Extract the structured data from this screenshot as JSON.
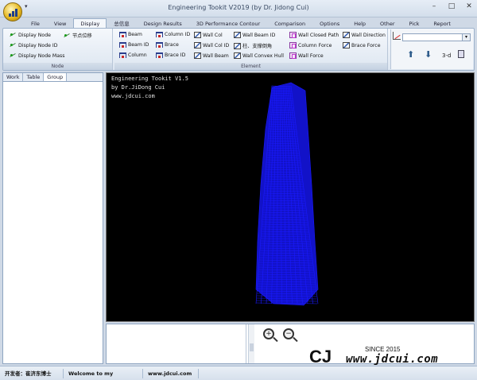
{
  "window": {
    "title": "Engineering Tookit V2019 (by Dr. Jidong Cui)",
    "qat": "▾",
    "minimize": "–",
    "maximize": "□",
    "close": "✕"
  },
  "tabs": [
    "File",
    "View",
    "Display",
    "总信息",
    "Design Results",
    "3D Performance Contour",
    "Comparison",
    "Options",
    "Help",
    "Other",
    "Pick",
    "Report"
  ],
  "active_tab": "Display",
  "ribbon": {
    "node_group": {
      "label": "Node",
      "items": [
        "Display Node",
        "Display Node ID",
        "Display Node Mass",
        "节点位移"
      ]
    },
    "element_group": {
      "label": "Element",
      "col1": [
        "Beam",
        "Beam ID",
        "Column"
      ],
      "col2": [
        "Column ID",
        "Brace",
        "Brace ID"
      ],
      "col3": [
        "Wall Col",
        "Wall Col ID",
        "Wall Beam"
      ],
      "col4": [
        "Wall Beam ID",
        "柱、支撑倒角",
        "Wall Convex Hull"
      ],
      "col5": [
        "Wall Closed Path",
        "Column Force",
        "Wall Force"
      ],
      "col6": [
        "Wall Direction",
        "Brace Force"
      ]
    },
    "view_controls": {
      "combo_value": "",
      "combo_arrow": "▾",
      "up_arrow": "⬆",
      "down_arrow": "⬇",
      "mode_label": "3-d"
    }
  },
  "left_panel": {
    "tabs": [
      "Work",
      "Table",
      "Group"
    ],
    "active_tab": "Group"
  },
  "viewport": {
    "line1": "Engineering Tookit V1.5",
    "line2": "by Dr.JiDong Cui",
    "line3": "www.jdcui.com",
    "model_color": "#1a1aff",
    "background": "#000000"
  },
  "bottom_panel": {
    "zoom_in": "+",
    "zoom_out": "−",
    "logo_mark": "CJ",
    "logo_since": "SINCE 2015",
    "logo_url": "www.jdcui.com"
  },
  "statusbar": {
    "developer": "开发者：崔济东博士",
    "welcome": "Welcome to my Website :",
    "website": "www.jdcui.com"
  }
}
